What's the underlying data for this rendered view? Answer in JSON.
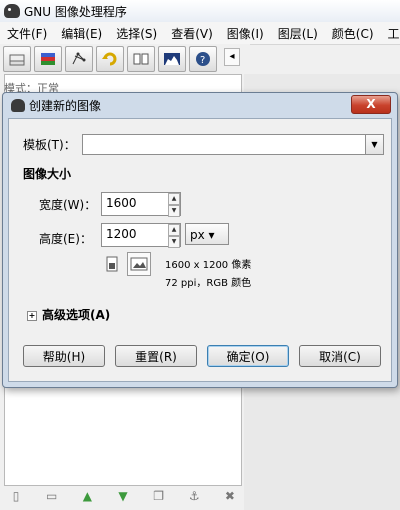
{
  "app": {
    "title": "GNU 图像处理程序"
  },
  "menu": [
    "文件(F)",
    "编辑(E)",
    "选择(S)",
    "查看(V)",
    "图像(I)",
    "图层(L)",
    "颜色(C)",
    "工"
  ],
  "layers_panel": {
    "mode_label": "模式：正常"
  },
  "dialog": {
    "title": "创建新的图像",
    "close_label": "X",
    "template_label": "模板(T)：",
    "template_value": "",
    "image_size_title": "图像大小",
    "width_label": "宽度(W)：",
    "width_value": "1600",
    "height_label": "高度(E)：",
    "height_value": "1200",
    "unit": "px",
    "size_info": "1600 x 1200 像素",
    "res_info": "72 ppi，RGB 颜色",
    "advanced_label": "高级选项(A)",
    "buttons": {
      "help": "帮助(H)",
      "reset": "重置(R)",
      "ok": "确定(O)",
      "cancel": "取消(C)"
    }
  },
  "icons": {
    "toolbar": [
      "layers-stack-icon",
      "color-stack-icon",
      "paths-icon",
      "undo-history-icon",
      "channels-icon",
      "histogram-icon",
      "help-icon"
    ],
    "bottom": [
      "new-layer-icon",
      "folder-icon",
      "raise-layer-icon",
      "lower-layer-icon",
      "duplicate-icon",
      "anchor-icon",
      "trash-icon"
    ]
  }
}
